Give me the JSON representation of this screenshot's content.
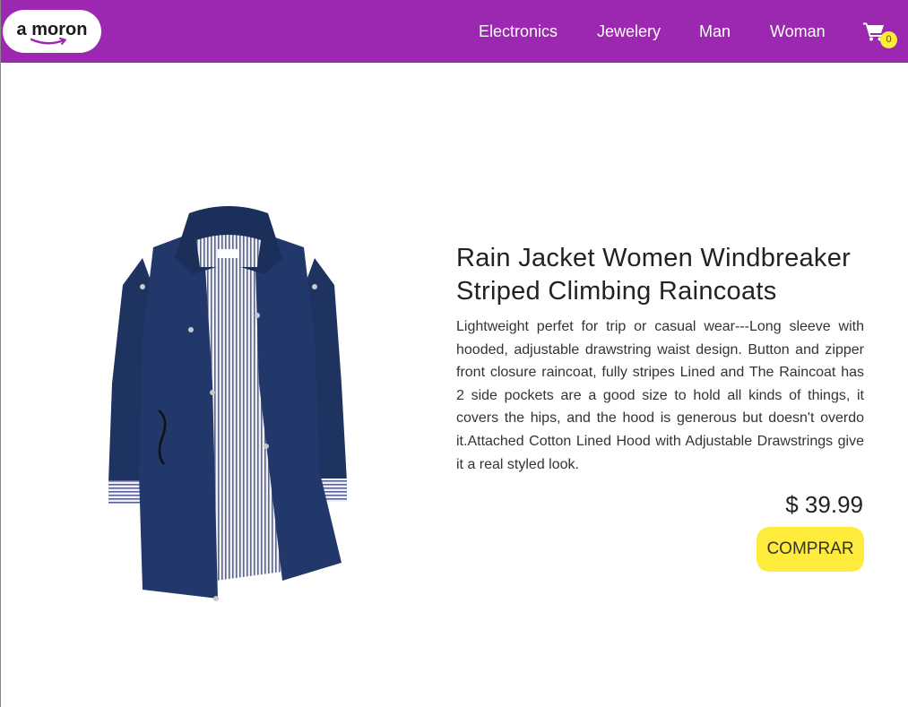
{
  "brand": {
    "logo_text": "a moron",
    "accent_color": "#9c27b0"
  },
  "nav": {
    "items": [
      {
        "label": "Electronics"
      },
      {
        "label": "Jewelery"
      },
      {
        "label": "Man"
      },
      {
        "label": "Woman"
      }
    ],
    "cart": {
      "icon": "cart-icon",
      "count": "0",
      "badge_color": "#ffeb3b"
    }
  },
  "product": {
    "title": "Rain Jacket Women Windbreaker Striped Climbing Raincoats",
    "description": "Lightweight perfet for trip or casual wear---Long sleeve with hooded, adjustable drawstring waist design. Button and zipper front closure raincoat, fully stripes Lined and The Raincoat has 2 side pockets are a good size to hold all kinds of things, it covers the hips, and the hood is generous but doesn't overdo it.Attached Cotton Lined Hood with Adjustable Drawstrings give it a real styled look.",
    "price": "$ 39.99",
    "buy_label": "COMPRAR",
    "button_color": "#ffeb3b"
  }
}
